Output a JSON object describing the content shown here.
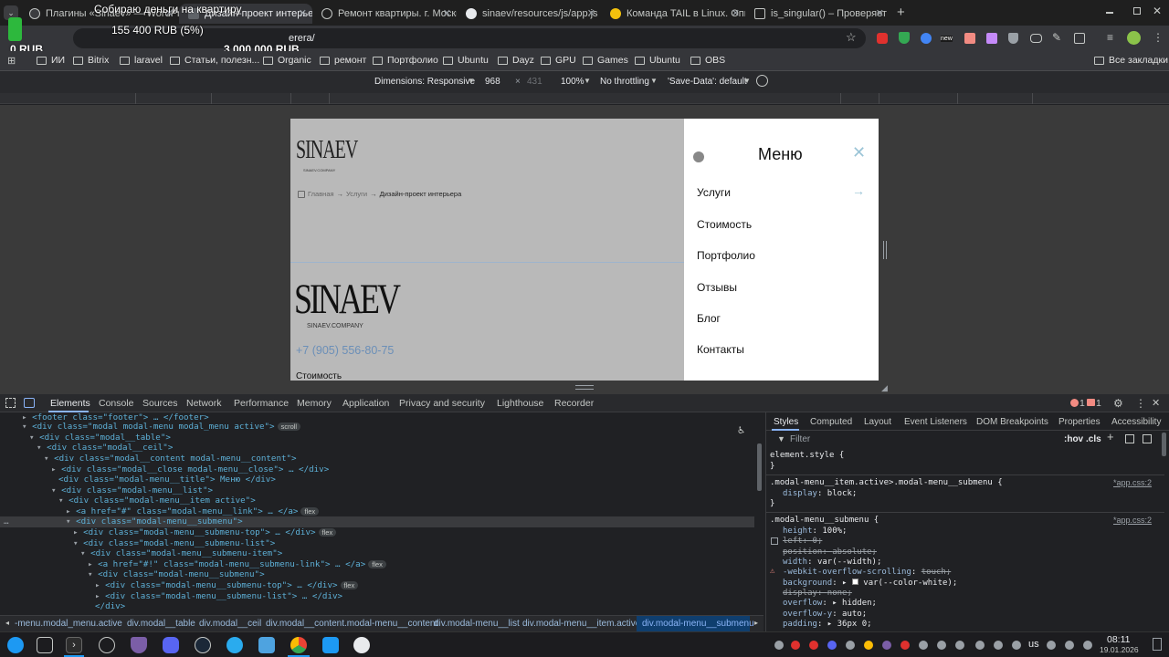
{
  "tabs": [
    {
      "title": "Плагины «Sinaev» — WordPress",
      "active": false
    },
    {
      "title": "Дизайн-проект интерьера",
      "active": true
    },
    {
      "title": "Ремонт квартиры. г. Москва",
      "active": false
    },
    {
      "title": "sinaev/resources/js/app.js",
      "active": false
    },
    {
      "title": "Команда TAIL в Linux. Опи",
      "active": false
    },
    {
      "title": "is_singular() – Проверяет",
      "active": false
    }
  ],
  "new_tab": "+",
  "donation": {
    "title": "Собираю деньги на квартиру",
    "current": "155 400 RUB (5%)",
    "min": "0 RUB",
    "max": "3 000 000 RUB",
    "progress_percent": 5
  },
  "address": {
    "url_fragment": "erera/"
  },
  "extensions": {
    "new_badge": "new"
  },
  "bookmarks": [
    "ИИ",
    "Bitrix",
    "laravel",
    "Статьи, полезн...",
    "Organic",
    "ремонт",
    "Портфолио",
    "Ubuntu",
    "Dayz",
    "GPU",
    "Games",
    "Ubuntu",
    "OBS"
  ],
  "all_bookmarks": "Все закладки",
  "device_toolbar": {
    "dimensions": "Dimensions: Responsive",
    "width": "968",
    "x": "×",
    "height": "431",
    "zoom": "100%",
    "throttle": "No throttling",
    "save_data": "'Save-Data': default"
  },
  "site": {
    "logo_small": "SINAEV",
    "logo_small_sub": "SINAEV.COMPANY",
    "breadcrumb": [
      "Главная",
      "Услуги",
      "Дизайн-проект интерьера"
    ],
    "logo_big": "SINAEV",
    "logo_big_sub": "SINAEV.COMPANY",
    "phone": "+7 (905) 556-80-75",
    "footer_link": "Стоимость"
  },
  "menu": {
    "title": "Меню",
    "items": [
      "Услуги",
      "Стоимость",
      "Портфолио",
      "Отзывы",
      "Блог",
      "Контакты"
    ]
  },
  "devtools": {
    "tabs": [
      "Elements",
      "Console",
      "Sources",
      "Network",
      "Performance",
      "Memory",
      "Application",
      "Privacy and security",
      "Lighthouse",
      "Recorder"
    ],
    "errors": "1",
    "warnings": "1",
    "style_tabs": [
      "Styles",
      "Computed",
      "Layout",
      "Event Listeners",
      "DOM Breakpoints",
      "Properties",
      "Accessibility"
    ],
    "filter_placeholder": "Filter",
    "hov": ":hov",
    "cls": ".cls",
    "dom": [
      "<footer class=\"footer\"> … </footer>",
      "<div class=\"modal modal-menu modal_menu active\">",
      "<div class=\"modal__table\">",
      "<div class=\"modal__ceil\">",
      "<div class=\"modal__content modal-menu__content\">",
      "<div class=\"modal__close modal-menu__close\"> … </div>",
      "<div class=\"modal-menu__title\"> Меню </div>",
      "<div class=\"modal-menu__list\">",
      "<div class=\"modal-menu__item active\">",
      "<a href=\"#\" class=\"modal-menu__link\"> … </a>",
      "<div class=\"modal-menu__submenu\">",
      "<div class=\"modal-menu__submenu-top\"> … </div>",
      "<div class=\"modal-menu__submenu-list\">",
      "<div class=\"modal-menu__submenu-item\">",
      "<a href=\"#!\" class=\"modal-menu__submenu-link\"> … </a>",
      "<div class=\"modal-menu__submenu\">",
      "<div class=\"modal-menu__submenu-top\"> … </div>",
      "<div class=\"modal-menu__submenu-list\"> … </div>",
      "</div>"
    ],
    "pills": {
      "scroll": "scroll",
      "flex": "flex"
    },
    "styles": {
      "element_style": "element.style {",
      "close": "}",
      "rule1_selector": ".modal-menu__item.active>.modal-menu__submenu {",
      "rule1_source": "*app.css:2",
      "rule1_props": [
        {
          "name": "display",
          "value": "block;"
        }
      ],
      "rule2_selector": ".modal-menu__submenu {",
      "rule2_source": "*app.css:2",
      "rule2_props": [
        {
          "name": "height",
          "value": "100%;"
        },
        {
          "name": "left",
          "value": "0;"
        },
        {
          "name": "position",
          "value": "absolute;"
        },
        {
          "name": "width",
          "value": "var(--width);"
        },
        {
          "name": "-webkit-overflow-scrolling",
          "value": "touch;"
        },
        {
          "name": "background",
          "value": "var(--color-white);"
        },
        {
          "name": "display",
          "value": "none;"
        },
        {
          "name": "overflow",
          "value": "hidden;"
        },
        {
          "name": "overflow-y",
          "value": "auto;"
        },
        {
          "name": "padding",
          "value": "36px 0;"
        }
      ]
    },
    "breadcrumbs": [
      "-menu.modal_menu.active",
      "div.modal__table",
      "div.modal__ceil",
      "div.modal__content.modal-menu__content",
      "div.modal-menu__list",
      "div.modal-menu__item.active",
      "div.modal-menu__submenu"
    ]
  },
  "taskbar": {
    "lang": "us",
    "time": "08:11",
    "date": "19.01.2026"
  },
  "colors": {
    "accent": "#8ab4f8",
    "donate_green": "#2db83d",
    "phone": "#6b8fb8"
  }
}
